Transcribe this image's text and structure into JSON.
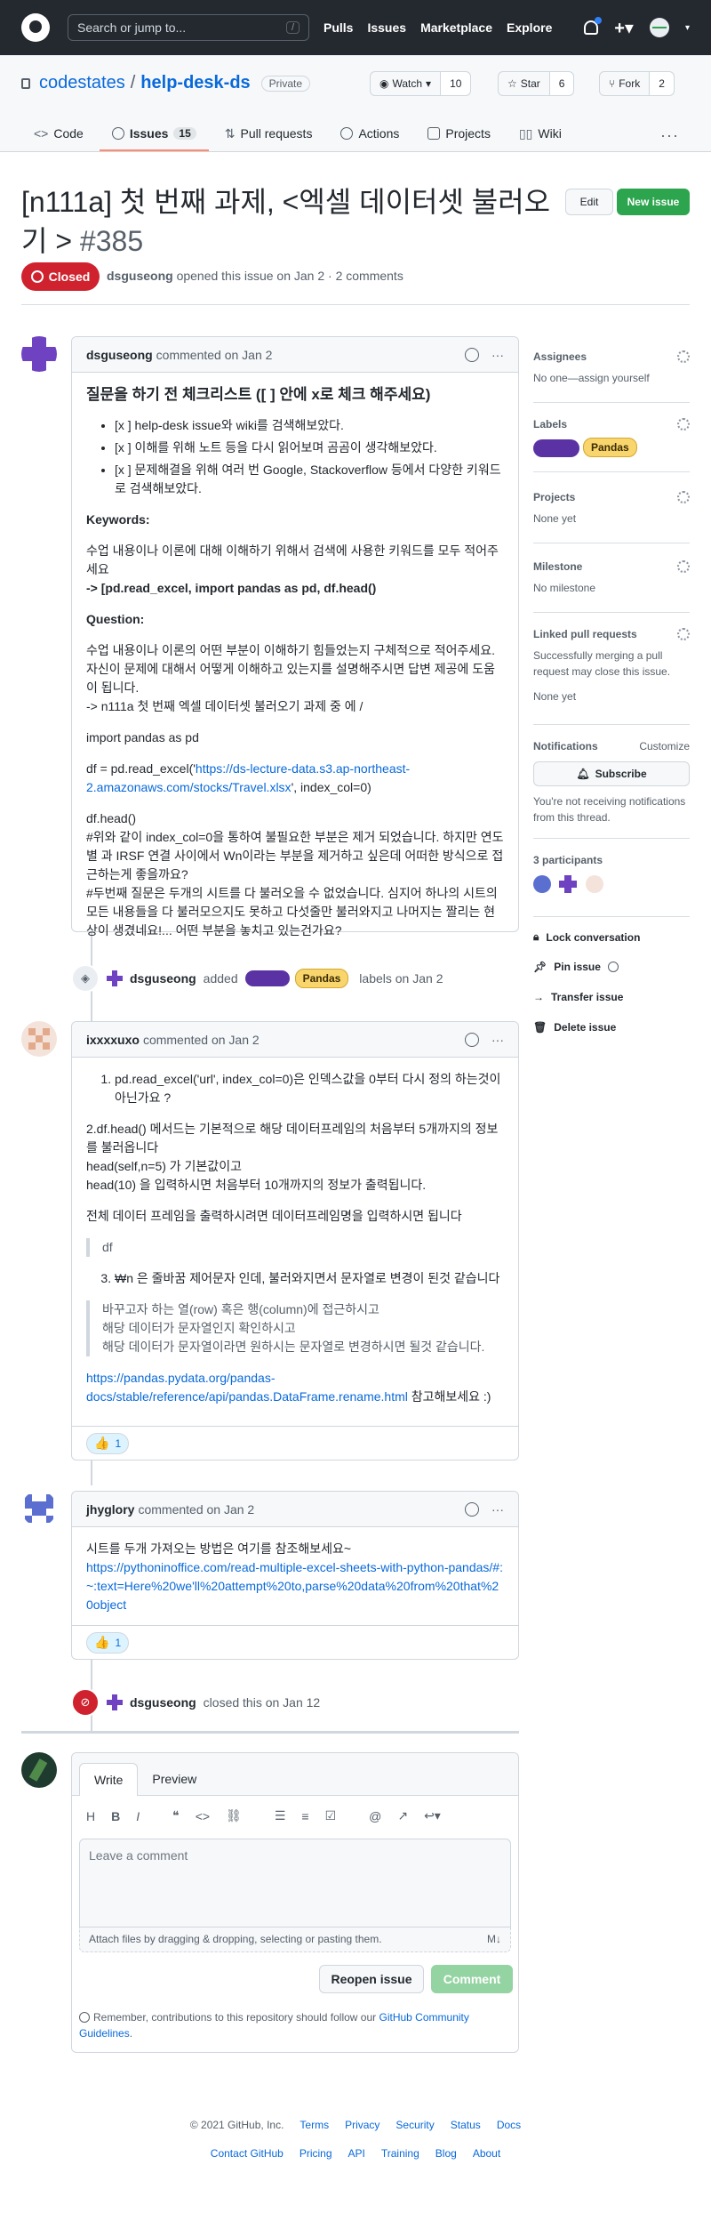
{
  "header": {
    "search_placeholder": "Search or jump to...",
    "slash": "/",
    "nav": [
      "Pulls",
      "Issues",
      "Marketplace",
      "Explore"
    ],
    "plus": "+▾"
  },
  "repo": {
    "owner": "codestates",
    "sep": "/",
    "name": "help-desk-ds",
    "visibility": "Private",
    "watch_label": "Watch",
    "watch_count": "10",
    "star_label": "Star",
    "star_count": "6",
    "fork_label": "Fork",
    "fork_count": "2",
    "tabs": [
      {
        "label": "Code"
      },
      {
        "label": "Issues",
        "count": "15"
      },
      {
        "label": "Pull requests"
      },
      {
        "label": "Actions"
      },
      {
        "label": "Projects"
      },
      {
        "label": "Wiki"
      }
    ],
    "more": "···"
  },
  "issue": {
    "title": "[n111a] 첫 번째 과제, <엑셀 데이터셋 불러오기 >",
    "number": "#385",
    "edit_label": "Edit",
    "new_issue_label": "New issue",
    "status": "Closed",
    "author": "dsguseong",
    "meta": "opened this issue on Jan 2 · 2 comments"
  },
  "comments": {
    "c1": {
      "author": "dsguseong",
      "meta": "commented on Jan 2",
      "h": "질문을 하기 전 체크리스트 ([ ] 안에 x로 체크 해주세요)",
      "list": [
        "[x ] help-desk issue와 wiki를 검색해보았다.",
        "[x ] 이해를 위해 노트 등을 다시 읽어보며 곰곰이 생각해보았다.",
        "[x ] 문제해결을 위해 여러 번 Google, Stackoverflow 등에서 다양한 키워드로 검색해보았다."
      ],
      "kw_title": "Keywords:",
      "kw_text": "수업 내용이나 이론에 대해 이해하기 위해서 검색에 사용한 키워드를 모두 적어주세요",
      "kw_bold": "-> [pd.read_excel, import pandas as pd, df.head()",
      "q_title": "Question:",
      "q_text": "수업 내용이나 이론의 어떤 부분이 이해하기 힘들었는지 구체적으로 적어주세요. 자신이 문제에 대해서 어떻게 이해하고 있는지를 설명해주시면 답변 제공에 도움이 됩니다.",
      "q_text2": "-> n111a 첫 번째 엑셀 데이터셋 불러오기 과제 중 에 /",
      "import": "import pandas as pd",
      "df_pre": "df = pd.read_excel('",
      "df_link": "https://ds-lecture-data.s3.ap-northeast-2.amazonaws.com/stocks/Travel.xlsx",
      "df_post": "', index_col=0)",
      "head": "df.head()",
      "n1": "#위와 같이 index_col=0을 통하여 불필요한 부분은 제거 되었습니다. 하지만 연도별 과 IRSF 연결 사이에서 Wn이라는 부분을 제거하고 싶은데 어떠한 방식으로 접근하는게 좋을까요?",
      "n2": "#두번째 질문은 두개의 시트를 다 불러오을 수 없었습니다. 심지어 하나의 시트의 모든 내용들을 다 불러모으지도 못하고 다섯줄만 불러와지고 나머지는 짤리는 현상이 생겼네요!... 어떤 부분을 놓치고 있는건가요?"
    },
    "label_event": {
      "author": "dsguseong",
      "added": "added",
      "label": "Pandas",
      "rest": "labels on Jan 2"
    },
    "c2": {
      "author": "ixxxxuxo",
      "meta": "commented on Jan 2",
      "l1": "pd.read_excel('url', index_col=0)은 인덱스값을 0부터 다시 정의 하는것이 아닌가요 ?",
      "p1": "2.df.head() 메서드는 기본적으로 해당 데이터프레임의 처음부터 5개까지의 정보를 불러옵니다",
      "p1b": "head(self,n=5) 가 기본값이고",
      "p1c": "head(10) 을 입력하시면 처음부터 10개까지의 정보가 출력됩니다.",
      "p2": "전체 데이터 프레임을 출력하시려면 데이터프레임명을 입력하시면 됩니다",
      "q1": "df",
      "l3": "₩n 은 줄바꿈 제어문자 인데, 불러와지면서 문자열로 변경이 된것 같습니다",
      "q2a": "바꾸고자 하는 열(row) 혹은 행(column)에 접근하시고",
      "q2b": "해당 데이터가 문자열인지 확인하시고",
      "q2c": "해당 데이터가 문자열이라면 원하시는 문자열로 변경하시면 될것 같습니다.",
      "link": "https://pandas.pydata.org/pandas-docs/stable/reference/api/pandas.DataFrame.rename.html",
      "link_post": " 참고해보세요 :)",
      "reaction": "1"
    },
    "c3": {
      "author": "jhyglory",
      "meta": "commented on Jan 2",
      "p": "시트를 두개 가져오는 방법은 여기를 참조해보세요~",
      "link": "https://pythoninoffice.com/read-multiple-excel-sheets-with-python-pandas/#:~:text=Here%20we'll%20attempt%20to,parse%20data%20from%20that%20object",
      "reaction": "1"
    },
    "closed_event": {
      "author": "dsguseong",
      "text": "closed this on Jan 12"
    }
  },
  "sidebar": {
    "assignees_title": "Assignees",
    "assignees_value": "No one—assign yourself",
    "labels_title": "Labels",
    "label_pandas": "Pandas",
    "projects_title": "Projects",
    "projects_value": "None yet",
    "milestone_title": "Milestone",
    "milestone_value": "No milestone",
    "linked_title": "Linked pull requests",
    "linked_text": "Successfully merging a pull request may close this issue.",
    "linked_value": "None yet",
    "notifications_title": "Notifications",
    "customize": "Customize",
    "subscribe": "Subscribe",
    "notif_text": "You're not receiving notifications from this thread.",
    "participants": "3 participants",
    "lock": "Lock conversation",
    "pin": "Pin issue",
    "transfer": "Transfer issue",
    "delete": "Delete issue"
  },
  "editor": {
    "write_tab": "Write",
    "preview_tab": "Preview",
    "tools": [
      "H",
      "B",
      "I"
    ],
    "placeholder": "Leave a comment",
    "attach": "Attach files by dragging & dropping, selecting or pasting them.",
    "md": "M↓",
    "reopen": "Reopen issue",
    "comment": "Comment",
    "remind_pre": "Remember, contributions to this repository should follow our ",
    "remind_link": "GitHub Community Guidelines",
    "remind_post": "."
  },
  "footer": {
    "copy": "© 2021 GitHub, Inc.",
    "row1": [
      "Terms",
      "Privacy",
      "Security",
      "Status",
      "Docs"
    ],
    "row2": [
      "Contact GitHub",
      "Pricing",
      "API",
      "Training",
      "Blog",
      "About"
    ]
  },
  "colors": {
    "accent": "#0969da",
    "closed": "#cf222e",
    "new_issue": "#2da44e",
    "label_purple": "#5a32a3",
    "label_pandas": "#f9d56e"
  }
}
